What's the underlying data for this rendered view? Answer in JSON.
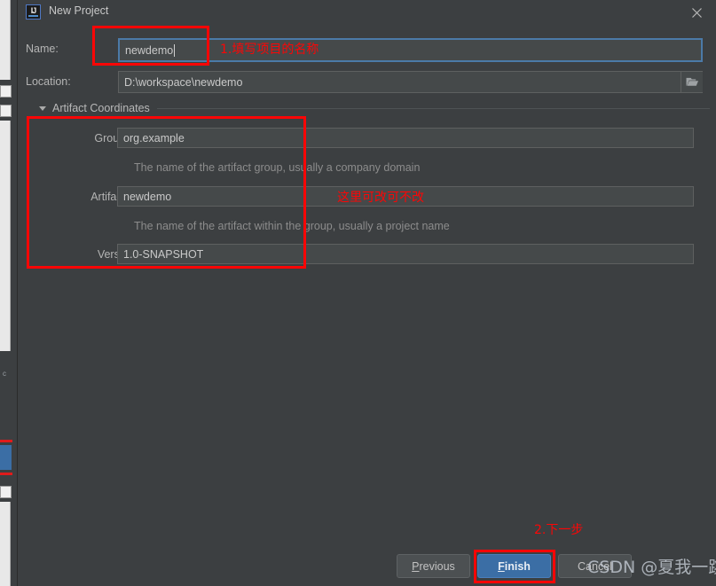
{
  "window": {
    "title": "New Project",
    "app_icon": "intellij-idea-icon",
    "close_icon": "close-icon"
  },
  "form": {
    "name": {
      "label": "Name:",
      "value": "newdemo",
      "focused": true
    },
    "location": {
      "label": "Location:",
      "value": "D:\\workspace\\newdemo",
      "browse_icon": "folder-icon"
    }
  },
  "section": {
    "title": "Artifact Coordinates",
    "expanded": true,
    "collapse_icon": "chevron-down-icon",
    "fields": {
      "group_id": {
        "label": "GroupId:",
        "value": "org.example",
        "hint": "The name of the artifact group, usually a company domain"
      },
      "artifact_id": {
        "label": "ArtifactId:",
        "value": "newdemo",
        "hint": "The name of the artifact within the group, usually a project name"
      },
      "version": {
        "label": "Version:",
        "value": "1.0-SNAPSHOT"
      }
    }
  },
  "buttons": {
    "previous": "Previous",
    "previous_mnemonic": "P",
    "previous_rest": "revious",
    "finish": "Finish",
    "finish_mnemonic": "F",
    "finish_rest": "inish",
    "cancel": "Cancel"
  },
  "annotations": {
    "step1": "1.填写项目的名称",
    "step2_note": "这里可改可不改",
    "step3": "2.下一步"
  },
  "watermark": {
    "brand": "CSDN",
    "user": "@夏我一跳"
  },
  "colors": {
    "annotation_red": "#fb0606",
    "primary_button": "#3b6ea5",
    "dialog_background": "#3c3f41",
    "field_background": "#45494a",
    "focus_border": "#4b7aa8"
  }
}
